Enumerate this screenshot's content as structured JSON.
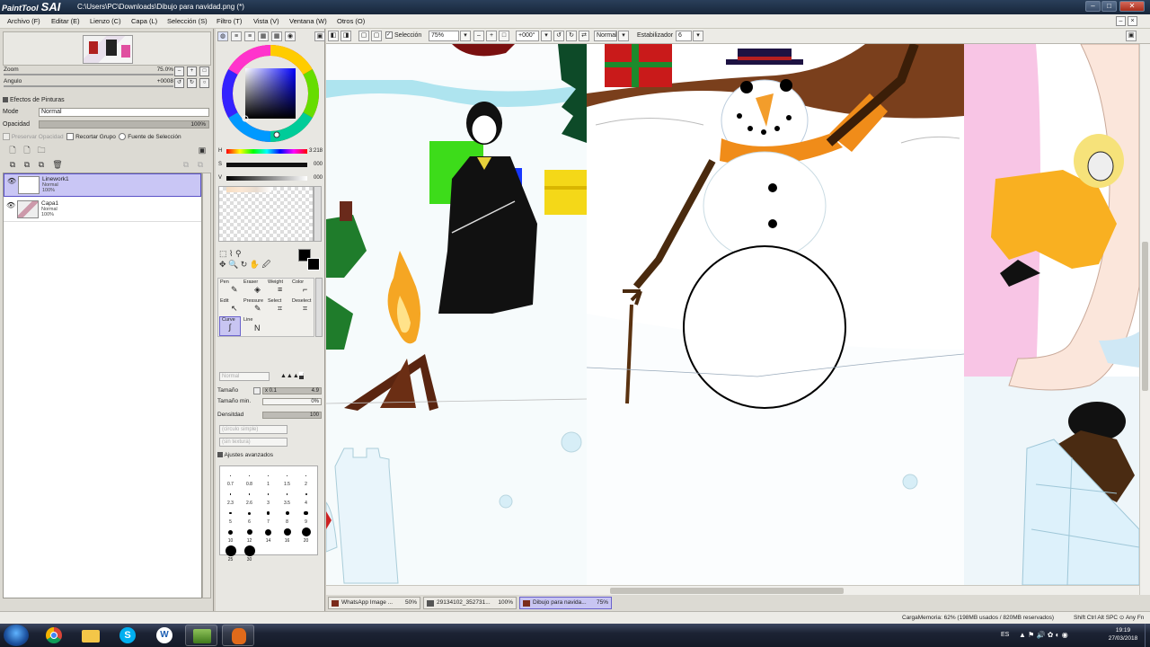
{
  "window": {
    "app_name": "PaintTool",
    "app_sai": "SAI",
    "title": "C:\\Users\\PC\\Downloads\\Dibujo para navidad.png (*)"
  },
  "menu": [
    "Archivo (F)",
    "Editar (E)",
    "Lienzo (C)",
    "Capa (L)",
    "Selección (S)",
    "Filtro (T)",
    "Vista (V)",
    "Ventana (W)",
    "Otros (O)"
  ],
  "navigator": {
    "zoom_label": "Zoom",
    "zoom_value": "75.0%",
    "angle_label": "Angulo",
    "angle_value": "+0008"
  },
  "layers_panel": {
    "effects_label": "Efectos de Pinturas",
    "mode_label": "Mode",
    "mode_value": "Normal",
    "opacity_label": "Opacidad",
    "opacity_value": "100%",
    "preserve_label": "Preservar Opacidad",
    "clip_label": "Recortar Grupo",
    "selection_source_label": "Fuente de Selección",
    "layers": [
      {
        "name": "Linework1",
        "mode": "Normal",
        "opacity": "100%",
        "selected": true
      },
      {
        "name": "Capa1",
        "mode": "Normal",
        "opacity": "100%",
        "selected": false
      }
    ]
  },
  "color_panel": {
    "h_label": "H",
    "h_value": "3:218",
    "s_label": "S",
    "s_value": "000",
    "v_label": "V",
    "v_value": "000"
  },
  "tools": {
    "top_row": [
      "Pen",
      "Eraser",
      "Weight",
      "Color"
    ],
    "mid_row": [
      "Edit",
      "Pressure",
      "Select",
      "Deselect"
    ],
    "bottom_row": [
      "Curve",
      "Line"
    ]
  },
  "brush_props": {
    "mode_value": "Normal",
    "size_label": "Tamaño",
    "size_mult": "x 0.1",
    "size_value": "4.9",
    "min_size_label": "Tamaño min.",
    "min_size_value": "0%",
    "density_label": "Densitdad",
    "density_value": "100",
    "shape_value": "(circulo simple)",
    "texture_value": "(sin textura)",
    "advanced_label": "Ajustes avanzados",
    "brush_sizes": [
      "0.7",
      "0.8",
      "1",
      "1.5",
      "2",
      "2.3",
      "2.6",
      "3",
      "3.5",
      "4",
      "5",
      "6",
      "7",
      "8",
      "9",
      "10",
      "12",
      "14",
      "16",
      "20",
      "25",
      "30"
    ]
  },
  "toolbar": {
    "selection_label": "Selección",
    "zoom_value": "75%",
    "angle_value": "+000°",
    "mode_value": "Normal",
    "stabilizer_label": "Estabilizador",
    "stabilizer_value": "6"
  },
  "doc_tabs": [
    {
      "name": "WhatsApp Image ...",
      "zoom": "50%",
      "active": false
    },
    {
      "name": "29134102_352731...",
      "zoom": "100%",
      "active": false
    },
    {
      "name": "Dibujo para navida...",
      "zoom": "75%",
      "active": true
    }
  ],
  "status": {
    "memory": "CargaMemoria: 62% (198MB usados / 820MB reservados)",
    "keys": "Shift Ctrl Alt SPC ⊙ Any Fn"
  },
  "taskbar": {
    "lang": "ES",
    "time": "19:19",
    "date": "27/03/2018",
    "apps": [
      "start-orb",
      "chrome",
      "explorer",
      "skype",
      "wunderlist",
      "painttool-sai",
      "hand-app"
    ]
  }
}
